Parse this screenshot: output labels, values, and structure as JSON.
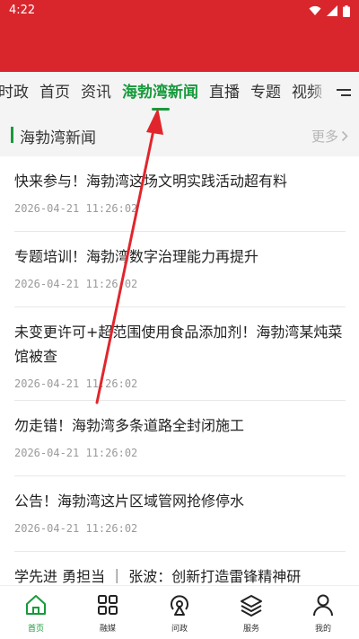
{
  "status_bar": {
    "time": "4:22"
  },
  "nav": {
    "tabs": [
      {
        "label": "时政",
        "active": false
      },
      {
        "label": "首页",
        "active": false
      },
      {
        "label": "资讯",
        "active": false
      },
      {
        "label": "海勃湾新闻",
        "active": true
      },
      {
        "label": "直播",
        "active": false
      },
      {
        "label": "专题",
        "active": false
      },
      {
        "label": "视频",
        "active": false
      }
    ],
    "menu_icon": "menu-icon"
  },
  "section": {
    "title": "海勃湾新闻",
    "more_label": "更多"
  },
  "news": [
    {
      "title": "快来参与！海勃湾这场文明实践活动超有料",
      "time": "2026-04-21 11:26:02"
    },
    {
      "title": "专题培训！海勃湾数字治理能力再提升",
      "time": "2026-04-21 11:26:02"
    },
    {
      "title": "未变更许可+超范围使用食品添加剂！海勃湾某炖菜馆被查",
      "time": "2026-04-21 11:26:02"
    },
    {
      "title": "勿走错！海勃湾多条道路全封闭施工",
      "time": "2026-04-21 11:26:02"
    },
    {
      "title": "公告！海勃湾这片区域管网抢修停水",
      "time": "2026-04-21 11:26:02"
    },
    {
      "title": "学先进 勇担当 ｜ 张波：创新打造雷锋精神研",
      "time": ""
    }
  ],
  "bottom_nav": [
    {
      "label": "首页",
      "icon": "home-icon",
      "active": true
    },
    {
      "label": "融媒",
      "icon": "grid-icon",
      "active": false
    },
    {
      "label": "问政",
      "icon": "broadcast-icon",
      "active": false
    },
    {
      "label": "服务",
      "icon": "layers-icon",
      "active": false
    },
    {
      "label": "我的",
      "icon": "user-icon",
      "active": false
    }
  ],
  "colors": {
    "brand_red": "#d8262c",
    "accent_green": "#179a3c",
    "annotation_red": "#e0262c"
  }
}
